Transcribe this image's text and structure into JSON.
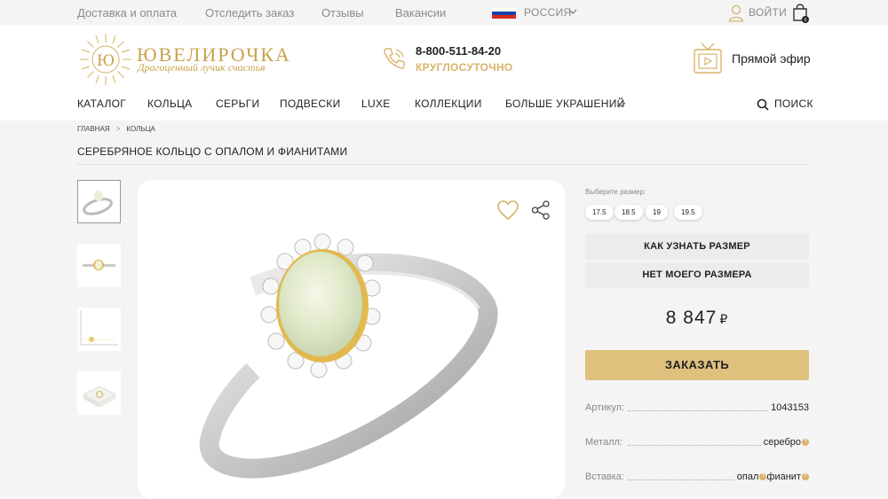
{
  "topbar": {
    "links": [
      "Доставка и оплата",
      "Отследить заказ",
      "Отзывы",
      "Вакансии"
    ],
    "country": "РОССИЯ",
    "login": "ВОЙТИ",
    "cart_count": "0"
  },
  "header": {
    "logo_name": "ЮВЕЛИРОЧКА",
    "logo_slogan": "Драгоценный лучик счастья",
    "logo_monogram": "Ю",
    "phone": "8-800-511-84-20",
    "phone_hours": "КРУГЛОСУТОЧНО",
    "live": "Прямой эфир"
  },
  "nav": {
    "items": [
      "КАТАЛОГ",
      "КОЛЬЦА",
      "СЕРЬГИ",
      "ПОДВЕСКИ",
      "LUXE",
      "КОЛЛЕКЦИИ",
      "БОЛЬШЕ УКРАШЕНИЙ"
    ],
    "search": "ПОИСК"
  },
  "breadcrumb": [
    "ГЛАВНАЯ",
    "КОЛЬЦА"
  ],
  "product": {
    "title": "СЕРЕБРЯНОЕ КОЛЬЦО С ОПАЛОМ И ФИАНИТАМИ",
    "size_prompt": "Выберите размер:",
    "sizes": [
      "17.5",
      "18.5",
      "19",
      "19.5"
    ],
    "how_to_size": "КАК УЗНАТЬ РАЗМЕР",
    "no_size": "НЕТ МОЕГО РАЗМЕРА",
    "price": "8 847",
    "currency": "₽",
    "order": "ЗАКАЗАТЬ",
    "specs": [
      {
        "label": "Артикул:",
        "value": "1043153"
      },
      {
        "label": "Металл:",
        "value": "серебро"
      },
      {
        "label": "Вставка:",
        "value": "опал",
        "value2": "фианит"
      }
    ]
  },
  "colors": {
    "gold": "#c9a24a",
    "accent": "#dfc07d",
    "muted": "#8a8a8a"
  }
}
